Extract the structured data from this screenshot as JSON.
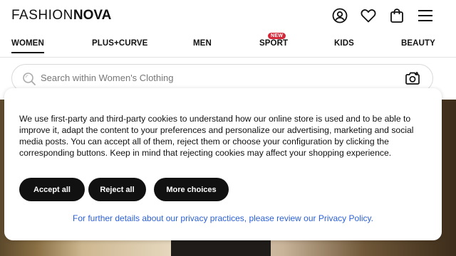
{
  "brand": {
    "logo_part1": "FASHION",
    "logo_part2": "NOVA"
  },
  "header": {
    "icons": [
      "account-icon",
      "heart-icon",
      "bag-icon",
      "menu-icon"
    ]
  },
  "nav": {
    "items": [
      {
        "label": "WOMEN",
        "active": true
      },
      {
        "label": "PLUS+CURVE"
      },
      {
        "label": "MEN"
      },
      {
        "label": "SPORT",
        "badge": "NEW"
      },
      {
        "label": "KIDS"
      },
      {
        "label": "BEAUTY"
      }
    ]
  },
  "search": {
    "placeholder": "Search within Women's Clothing"
  },
  "cookie": {
    "text": "We use first-party and third-party cookies to understand how our online store is used and to be able to improve it, adapt the content to your preferences and personalize our advertising, marketing and social media posts. You can accept all of them, reject them or choose your configuration by clicking the corresponding buttons. Keep in mind that rejecting cookies may affect your shopping experience.",
    "accept_label": "Accept all",
    "reject_label": "Reject all",
    "more_label": "More choices",
    "policy_text": "For further details about our privacy practices, please review our Privacy Policy."
  },
  "colors": {
    "accent": "#111111",
    "badge": "#d3283a",
    "link": "#2a5fd6"
  }
}
